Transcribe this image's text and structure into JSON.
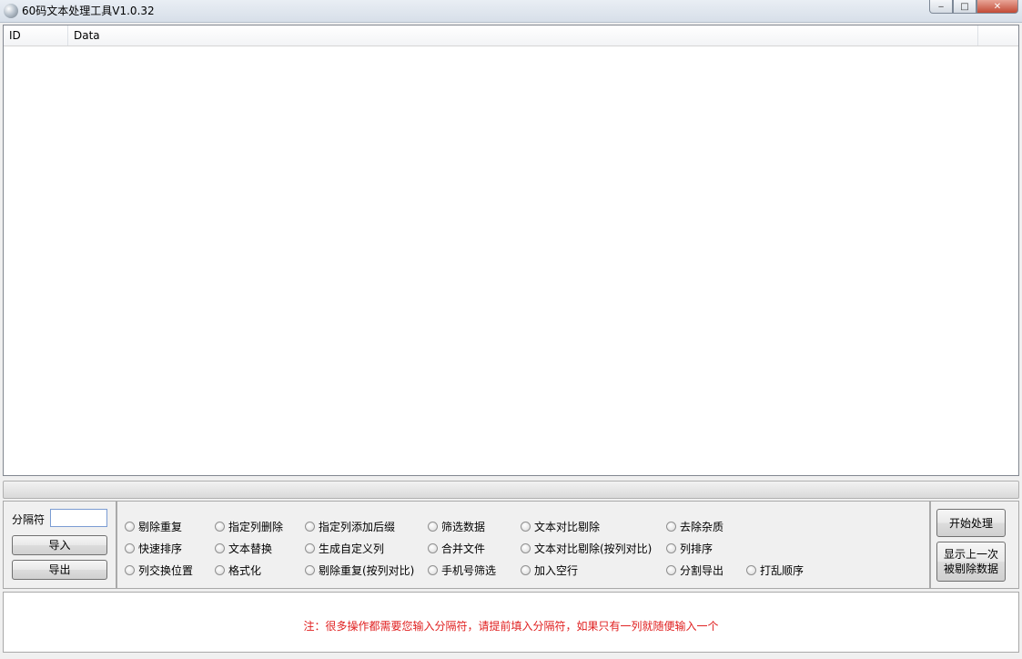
{
  "window": {
    "title": "60码文本处理工具V1.0.32",
    "min_label": "‒",
    "max_label": "□",
    "close_label": "✕"
  },
  "table": {
    "columns": [
      "ID",
      "Data"
    ],
    "rows": []
  },
  "left_panel": {
    "separator_label": "分隔符",
    "separator_value": "",
    "import_label": "导入",
    "export_label": "导出"
  },
  "options": [
    [
      "剔除重复",
      "指定列删除",
      "指定列添加后缀",
      "筛选数据",
      "文本对比剔除",
      "去除杂质"
    ],
    [
      "快速排序",
      "文本替换",
      "生成自定义列",
      "合并文件",
      "文本对比剔除(按列对比)",
      "列排序"
    ],
    [
      "列交换位置",
      "格式化",
      "剔除重复(按列对比)",
      "手机号筛选",
      "加入空行",
      "分割导出",
      "打乱顺序"
    ]
  ],
  "right_panel": {
    "start_label": "开始处理",
    "show_removed_label": "显示上一次被剔除数据"
  },
  "note": {
    "text": "注：很多操作都需要您输入分隔符，请提前填入分隔符，如果只有一列就随便输入一个",
    "color": "#e02020"
  }
}
